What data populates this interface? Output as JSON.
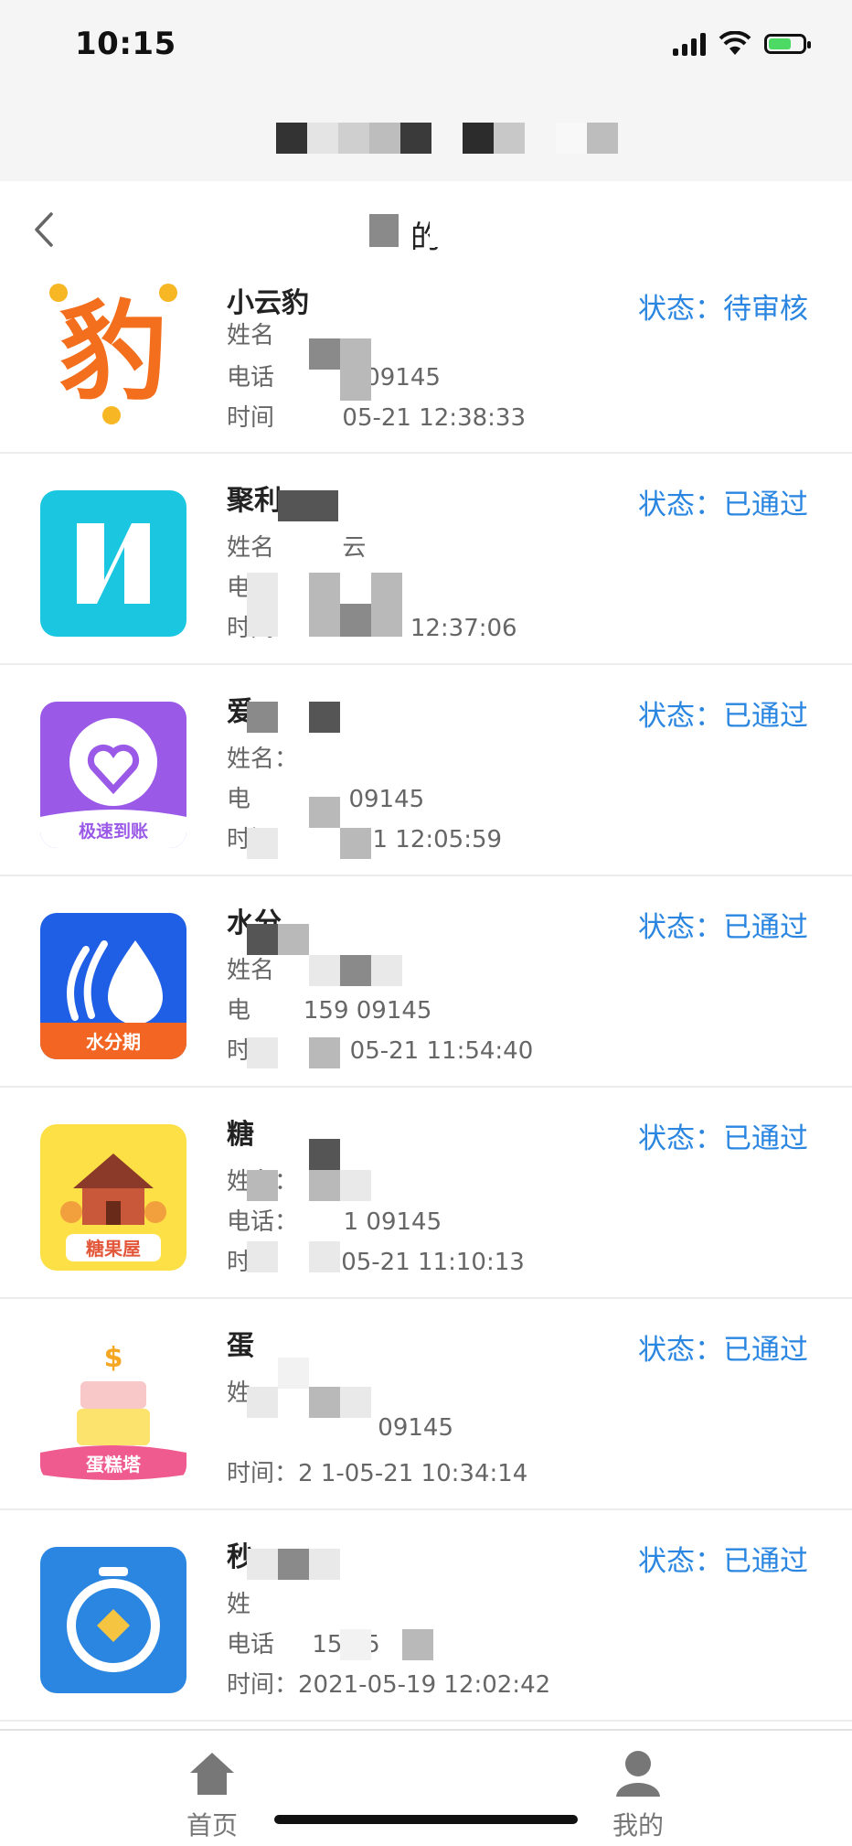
{
  "status_bar": {
    "time": "10:15"
  },
  "nav": {
    "title": "的",
    "back_icon": "chevron-left-icon"
  },
  "items": [
    {
      "name": "小云豹",
      "name_label": "姓名",
      "phone_label": "电话",
      "phone": "159 09145",
      "time_label": "时间",
      "time": "05-21 12:38:33",
      "status": "状态：待审核",
      "logo": "leopard-logo",
      "logo_char": "豹"
    },
    {
      "name": "聚利",
      "name_label": "姓名",
      "name_value": "云",
      "phone_label": "电话",
      "phone": "5",
      "time_label": "时间",
      "time": "21 12:37:06",
      "status": "状态：已通过",
      "logo": "letter-n-logo"
    },
    {
      "name": "爱",
      "name_label": "姓名：",
      "phone_label": "电",
      "phone": "09145",
      "time_label": "时间",
      "time": "21 12:05:59",
      "status": "状态：已通过",
      "logo": "heart-logo",
      "logo_text": "极速到账"
    },
    {
      "name": "水分",
      "name_label": "姓名",
      "phone_label": "电",
      "phone": "159 09145",
      "time_label": "时间",
      "time": "05-21 11:54:40",
      "status": "状态：已通过",
      "logo": "water-drop-logo",
      "logo_text": "水分期"
    },
    {
      "name": "糖",
      "name_label": "姓名：",
      "phone_label": "电话：",
      "phone": "1 09145",
      "time_label": "时",
      "time": "05-21 11:10:13",
      "status": "状态：已通过",
      "logo": "candy-house-logo",
      "logo_text": "糖果屋"
    },
    {
      "name": "蛋",
      "name_label": "姓",
      "phone_label": "",
      "phone": "09145",
      "time_label": "时间：",
      "time": "2 1-05-21 10:34:14",
      "status": "状态：已通过",
      "logo": "cake-logo",
      "logo_text": "蛋糕塔"
    },
    {
      "name": "秒",
      "name_label": "姓",
      "phone_label": "电话",
      "phone": "159 5",
      "time_label": "时间：",
      "time": "2021-05-19 12:02:42",
      "status": "状态：已通过",
      "logo": "stopwatch-logo"
    }
  ],
  "tabbar": [
    {
      "label": "首页",
      "icon": "home-icon"
    },
    {
      "label": "我的",
      "icon": "user-icon"
    }
  ],
  "colors": {
    "accent": "#2a86e0",
    "header_bg": "#f5f5f5"
  }
}
